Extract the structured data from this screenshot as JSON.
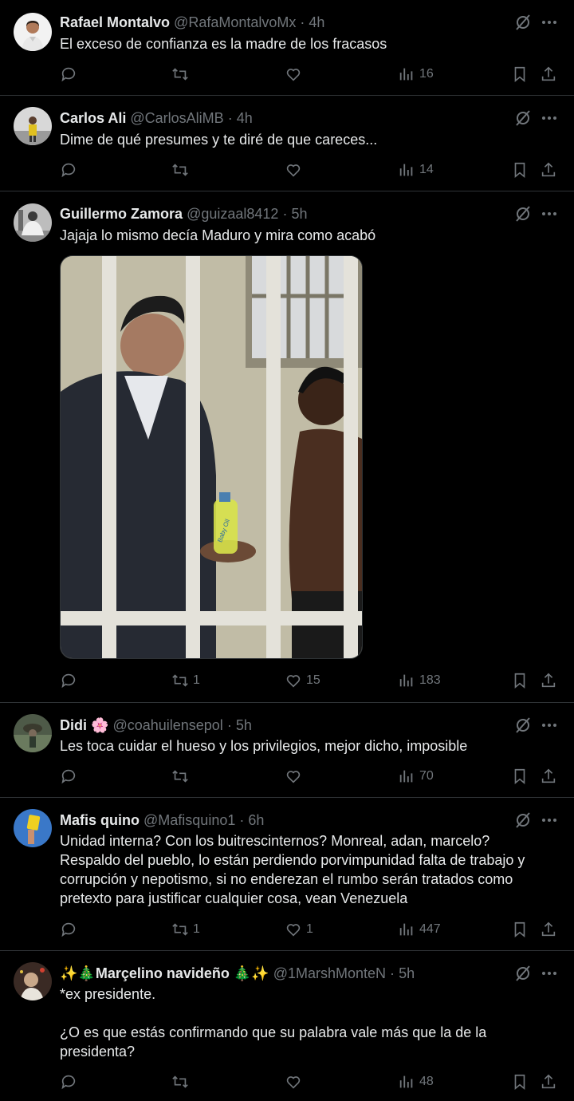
{
  "tweets": [
    {
      "name": "Rafael Montalvo",
      "handle": "@RafaMontalvoMx",
      "time": "4h",
      "text": "El exceso de confianza es la madre de los fracasos",
      "replies": "",
      "retweets": "",
      "likes": "",
      "views": "16"
    },
    {
      "name": "Carlos Ali",
      "handle": "@CarlosAliMB",
      "time": "4h",
      "text": "Dime de qué presumes y te diré de que careces...",
      "replies": "",
      "retweets": "",
      "likes": "",
      "views": "14"
    },
    {
      "name": "Guillermo Zamora",
      "handle": "@guizaal8412",
      "time": "5h",
      "text": "Jajaja lo mismo decía Maduro y mira como acabó",
      "replies": "",
      "retweets": "1",
      "likes": "15",
      "views": "183",
      "media_label": "Baby Oil"
    },
    {
      "name": "Didi 🌸",
      "handle": "@coahuilensepol",
      "time": "5h",
      "text": "Les toca cuidar el hueso y los privilegios, mejor dicho, imposible",
      "replies": "",
      "retweets": "",
      "likes": "",
      "views": "70"
    },
    {
      "name": "Mafis quino",
      "handle": "@Mafisquino1",
      "time": "6h",
      "text": "Unidad interna? Con los buitrescinternos? Monreal, adan, marcelo?\nRespaldo del pueblo, lo están perdiendo porvimpunidad falta de trabajo y corrupción y nepotismo, si no enderezan el rumbo serán tratados como pretexto para justificar cualquier cosa, vean Venezuela",
      "replies": "",
      "retweets": "1",
      "likes": "1",
      "views": "447"
    },
    {
      "name": "✨🎄Marçelino navideño 🎄✨",
      "handle": "@1MarshMonteN",
      "time": "5h",
      "text": "*ex presidente.\n\n¿O es que estás confirmando que su palabra vale más que la de la presidenta?",
      "replies": "",
      "retweets": "",
      "likes": "",
      "views": "48"
    }
  ],
  "separator": "·",
  "icons": [
    "grok-icon",
    "more-icon",
    "reply-icon",
    "retweet-icon",
    "like-icon",
    "views-icon",
    "bookmark-icon",
    "share-icon"
  ],
  "colors": {
    "background": "#000000",
    "text": "#e7e9ea",
    "muted": "#71767b",
    "border": "#2f3336"
  }
}
